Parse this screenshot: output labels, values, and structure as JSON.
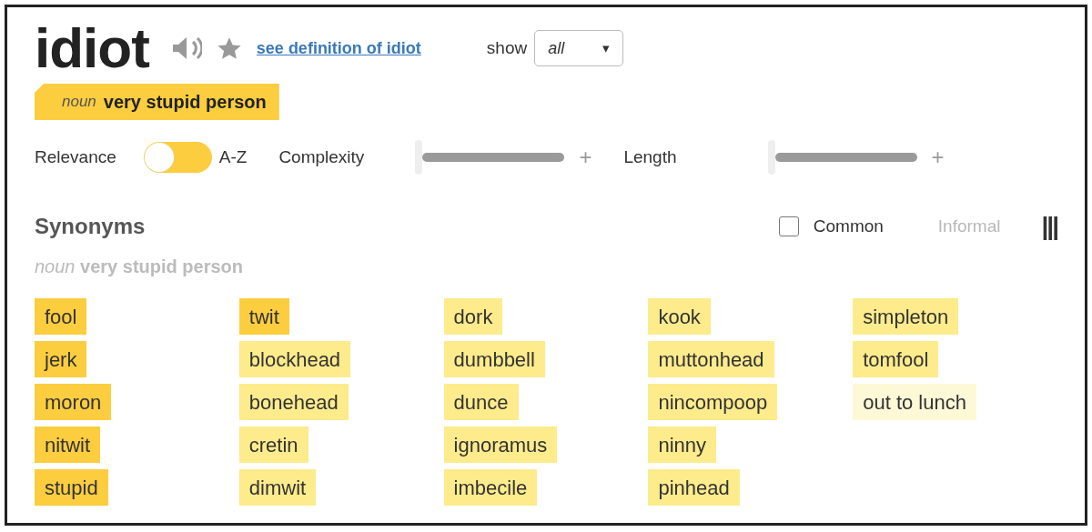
{
  "word": "idiot",
  "definition_link": "see definition of idiot",
  "show": {
    "label": "show",
    "value": "all",
    "caret": "▾"
  },
  "sense_tab": {
    "pos": "noun",
    "text": "very stupid person",
    "selected": true
  },
  "sort": {
    "left": "Relevance",
    "right": "A-Z",
    "az": false
  },
  "sliders": [
    {
      "label": "Complexity",
      "level": 0,
      "plus": "+"
    },
    {
      "label": "Length",
      "level": 0,
      "plus": "+"
    }
  ],
  "synonyms_title": "Synonyms",
  "sense_subtitle": {
    "pos": "noun",
    "text": "very stupid person"
  },
  "filters": [
    {
      "label": "Common",
      "checked": false
    },
    {
      "label": "Informal",
      "kind": "faint"
    }
  ],
  "columns_glyph": "|||",
  "synonym_columns": [
    [
      {
        "word": "fool",
        "color": "#fbcd3f"
      },
      {
        "word": "jerk",
        "color": "#fbcd3f"
      },
      {
        "word": "moron",
        "color": "#fbcd3f"
      },
      {
        "word": "nitwit",
        "color": "#fbcd3f"
      },
      {
        "word": "stupid",
        "color": "#fbcd3f"
      }
    ],
    [
      {
        "word": "twit",
        "color": "#fbcd3f"
      },
      {
        "word": "blockhead",
        "color": "#fdeb8c"
      },
      {
        "word": "bonehead",
        "color": "#fdeb8c"
      },
      {
        "word": "cretin",
        "color": "#fdeb8c"
      },
      {
        "word": "dimwit",
        "color": "#fdeb8c"
      }
    ],
    [
      {
        "word": "dork",
        "color": "#fdeb8c"
      },
      {
        "word": "dumbbell",
        "color": "#fdeb8c"
      },
      {
        "word": "dunce",
        "color": "#fdeb8c"
      },
      {
        "word": "ignoramus",
        "color": "#fdeb8c"
      },
      {
        "word": "imbecile",
        "color": "#fdeb8c"
      }
    ],
    [
      {
        "word": "kook",
        "color": "#fdeb8c"
      },
      {
        "word": "muttonhead",
        "color": "#fdeb8c"
      },
      {
        "word": "nincompoop",
        "color": "#fdeb8c"
      },
      {
        "word": "ninny",
        "color": "#fdeb8c"
      },
      {
        "word": "pinhead",
        "color": "#fdeb8c"
      }
    ],
    [
      {
        "word": "simpleton",
        "color": "#fdeb8c"
      },
      {
        "word": "tomfool",
        "color": "#fdeb8c"
      },
      {
        "word": "out to lunch",
        "color": "#fdf8d6"
      }
    ]
  ]
}
